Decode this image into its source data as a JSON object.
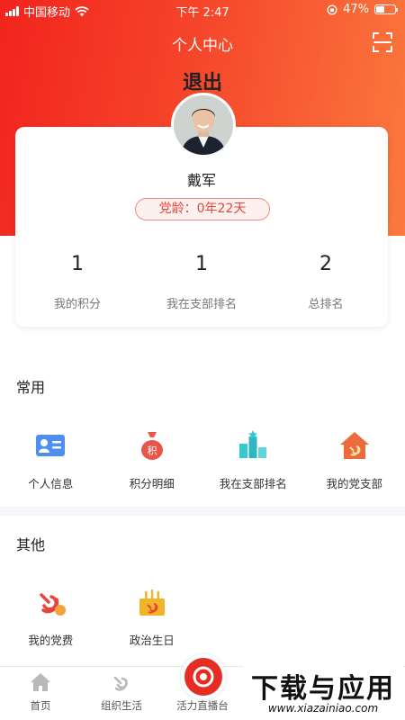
{
  "status_bar": {
    "carrier": "中国移动",
    "time": "下午 2:47",
    "battery": "47%",
    "battery_level": 0.47
  },
  "header": {
    "title": "个人中心",
    "scan_icon": "scan-icon"
  },
  "logout_label": "退出",
  "profile": {
    "name": "戴军",
    "party_age": "党龄：0年22天",
    "stats": [
      {
        "value": "1",
        "label": "我的积分"
      },
      {
        "value": "1",
        "label": "我在支部排名"
      },
      {
        "value": "2",
        "label": "总排名"
      }
    ]
  },
  "common": {
    "title": "常用",
    "items": [
      {
        "label": "个人信息",
        "icon": "id-card-icon"
      },
      {
        "label": "积分明细",
        "icon": "points-bag-icon"
      },
      {
        "label": "我在支部排名",
        "icon": "ranking-icon"
      },
      {
        "label": "我的党支部",
        "icon": "party-branch-icon"
      }
    ]
  },
  "other": {
    "title": "其他",
    "items": [
      {
        "label": "我的党费",
        "icon": "party-fee-icon"
      },
      {
        "label": "政治生日",
        "icon": "political-birthday-icon"
      }
    ]
  },
  "tabbar": {
    "items": [
      {
        "label": "首页",
        "icon": "home-icon"
      },
      {
        "label": "组织生活",
        "icon": "party-emblem-icon"
      },
      {
        "label": "活力直播台",
        "icon": "live-camera-icon"
      }
    ]
  },
  "watermark": {
    "main": "下载与应用",
    "sub": "www.xiazainiao.com"
  },
  "colors": {
    "primary": "#e52d23",
    "header_gradient_start": "#f2241d",
    "header_gradient_end": "#fb7a3e"
  }
}
